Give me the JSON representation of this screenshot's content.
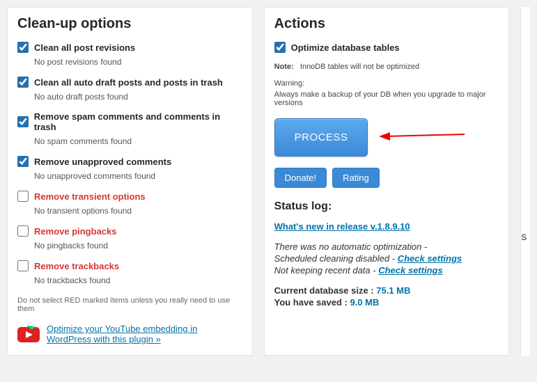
{
  "cleanup": {
    "title": "Clean-up options",
    "items": [
      {
        "label": "Clean all post revisions",
        "sub": "No post revisions found",
        "checked": true,
        "red": false
      },
      {
        "label": "Clean all auto draft posts and posts in trash",
        "sub": "No auto draft posts found",
        "checked": true,
        "red": false
      },
      {
        "label": "Remove spam comments and comments in trash",
        "sub": "No spam comments found",
        "checked": true,
        "red": false
      },
      {
        "label": "Remove unapproved comments",
        "sub": "No unapproved comments found",
        "checked": true,
        "red": false
      },
      {
        "label": "Remove transient options",
        "sub": "No transient options found",
        "checked": false,
        "red": true
      },
      {
        "label": "Remove pingbacks",
        "sub": "No pingbacks found",
        "checked": false,
        "red": true
      },
      {
        "label": "Remove trackbacks",
        "sub": "No trackbacks found",
        "checked": false,
        "red": true
      }
    ],
    "footnote": "Do not select RED marked items unless you really need to use them",
    "promo": "Optimize your YouTube embedding in WordPress with this plugin »"
  },
  "actions": {
    "title": "Actions",
    "optimize": {
      "label": "Optimize database tables",
      "checked": true
    },
    "note_label": "Note:",
    "note_text": "InnoDB tables will not be optimized",
    "warn_label": "Warning:",
    "warn_text": "Always make a backup of your DB when you upgrade to major versions",
    "process": "PROCESS",
    "donate": "Donate!",
    "rating": "Rating",
    "status_title": "Status log:",
    "whats_new": "What's new in release v.1.8.9.10",
    "auto_line": "There was no automatic optimization -",
    "sched_line": "Scheduled cleaning disabled - ",
    "keep_line": "Not keeping recent data - ",
    "check": "Check settings",
    "db_size_label": "Current database size : ",
    "db_size": "75.1 MB",
    "saved_label": "You have saved : ",
    "saved": "9.0 MB"
  },
  "edge": "S"
}
